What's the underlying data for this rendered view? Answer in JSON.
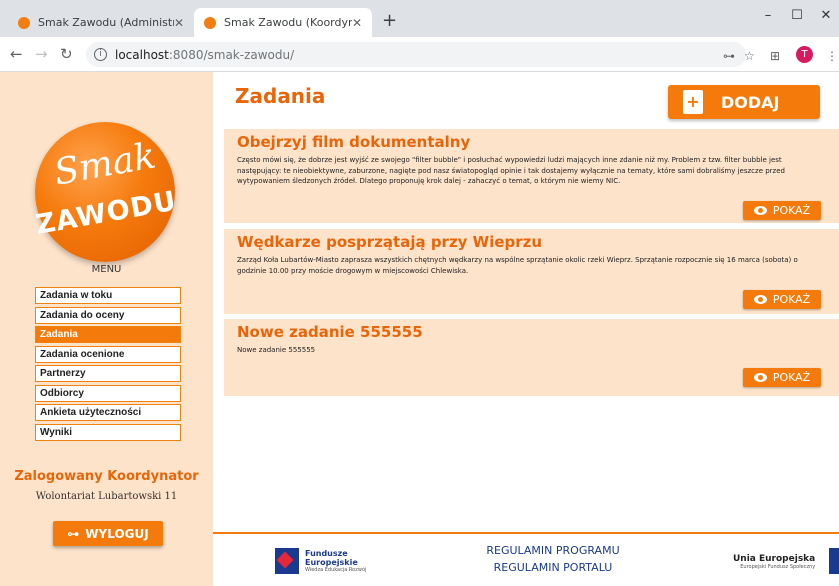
{
  "browser": {
    "tabs": [
      {
        "title": "Smak Zawodu (Administrator)",
        "active": false
      },
      {
        "title": "Smak Zawodu (Koordynator)",
        "active": true
      }
    ],
    "url_host": "localhost",
    "url_rest": ":8080/smak-zawodu/",
    "avatar_letter": "T"
  },
  "sidebar": {
    "logo_top": "Smak",
    "logo_bottom": "ZAWODU",
    "menu_header": "MENU",
    "menu_items": [
      {
        "label": "Zadania w toku",
        "active": false
      },
      {
        "label": "Zadania do oceny",
        "active": false
      },
      {
        "label": "Zadania",
        "active": true
      },
      {
        "label": "Zadania ocenione",
        "active": false
      },
      {
        "label": "Partnerzy",
        "active": false
      },
      {
        "label": "Odbiorcy",
        "active": false
      },
      {
        "label": "Ankieta użyteczności",
        "active": false
      },
      {
        "label": "Wyniki",
        "active": false
      }
    ],
    "logged_title": "Zalogowany Koordynator",
    "logged_name": "Wolontariat Lubartowski 11",
    "logout_label": "WYLOGUJ"
  },
  "main": {
    "title": "Zadania",
    "add_label": "DODAJ",
    "show_label": "POKAŻ",
    "tasks": [
      {
        "title": "Obejrzyj film dokumentalny",
        "description": "Często mówi się, że dobrze jest wyjść ze swojego \"filter bubble\" i posłuchać wypowiedzi ludzi mających inne zdanie niż my. Problem z tzw. filter bubble jest następujący: te nieobiektywne, zaburzone, nagięte pod nasz światopogląd opinie i tak dostajemy wyłącznie na tematy, które sami dobraliśmy jeszcze przed wytypowaniem śledzonych źródeł. Dlatego proponuję krok dalej - zahaczyć o temat, o którym nie wiemy NIC."
      },
      {
        "title": "Wędkarze posprzątają przy Wieprzu",
        "description": "Zarząd Koła Lubartów-Miasto zaprasza wszystkich chętnych wędkarzy na wspólne sprzątanie okolic rzeki Wieprz. Sprzątanie rozpocznie się 16 marca (sobota) o godzinie 10.00 przy moście drogowym w miejscowości Chlewiska."
      },
      {
        "title": "Nowe zadanie 555555",
        "description": "Nowe zadanie 555555"
      }
    ]
  },
  "footer": {
    "eu_funds_line1": "Fundusze",
    "eu_funds_line2": "Europejskie",
    "eu_funds_sub": "Wiedza Edukacja Rozwój",
    "regulamin_programu": "REGULAMIN PROGRAMU",
    "regulamin_portalu": "REGULAMIN PORTALU",
    "eu_union": "Unia Europejska",
    "eu_union_sub": "Europejski Fundusz Społeczny"
  },
  "colors": {
    "accent": "#f57a0c",
    "panel": "#fde3ca",
    "title": "#e8650a"
  }
}
